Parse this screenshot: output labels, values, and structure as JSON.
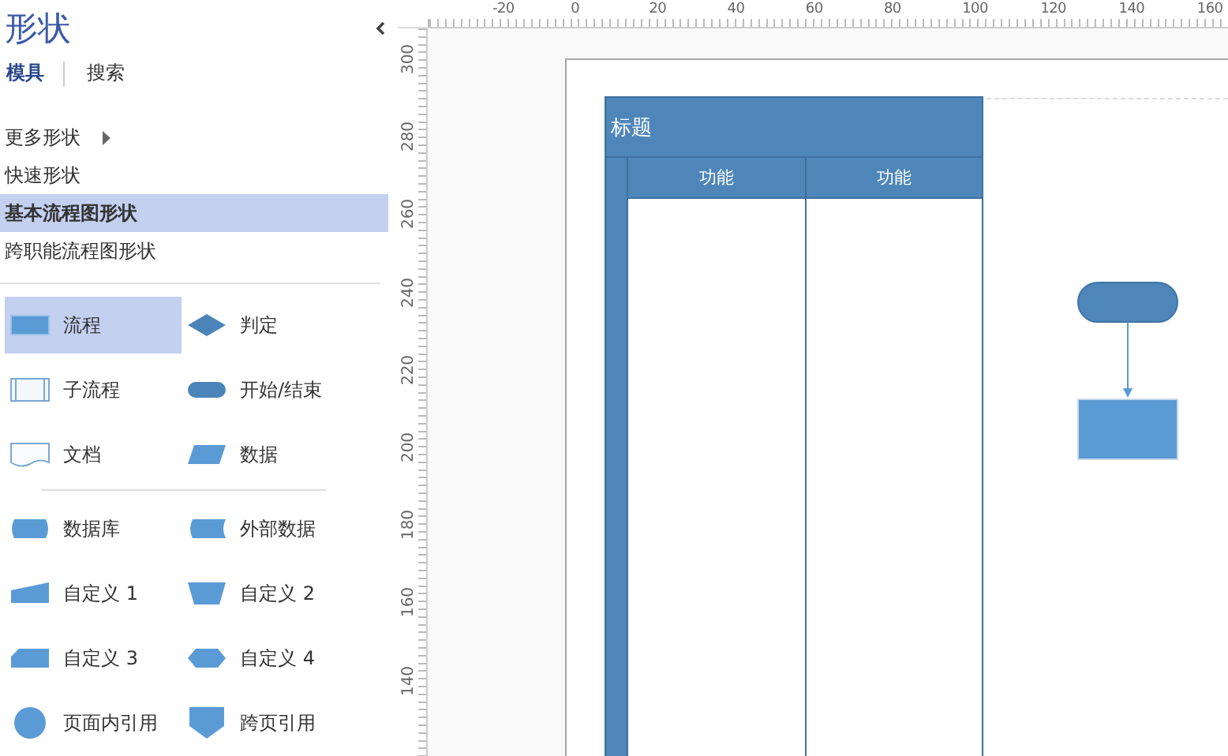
{
  "panel": {
    "title": "形状",
    "tabs": [
      {
        "label": "模具",
        "selected": true
      },
      {
        "label": "搜索",
        "selected": false
      }
    ],
    "stencils": [
      {
        "label": "更多形状",
        "kind": "submenu",
        "selected": false
      },
      {
        "label": "快速形状",
        "kind": "item",
        "selected": false
      },
      {
        "label": "基本流程图形状",
        "kind": "item",
        "selected": true
      },
      {
        "label": "跨职能流程图形状",
        "kind": "item",
        "selected": false
      }
    ],
    "shapes": [
      {
        "label": "流程",
        "kind": "process",
        "selected": true
      },
      {
        "label": "判定",
        "kind": "decision",
        "selected": false
      },
      {
        "label": "子流程",
        "kind": "subprocess",
        "selected": false
      },
      {
        "label": "开始/结束",
        "kind": "terminator",
        "selected": false
      },
      {
        "label": "文档",
        "kind": "document",
        "selected": false
      },
      {
        "label": "数据",
        "kind": "data",
        "selected": false
      }
    ],
    "more_shapes": [
      {
        "label": "数据库",
        "kind": "database",
        "selected": false
      },
      {
        "label": "外部数据",
        "kind": "external",
        "selected": false
      },
      {
        "label": "自定义 1",
        "kind": "custom1",
        "selected": false
      },
      {
        "label": "自定义 2",
        "kind": "custom2",
        "selected": false
      },
      {
        "label": "自定义 3",
        "kind": "custom3",
        "selected": false
      },
      {
        "label": "自定义 4",
        "kind": "custom4",
        "selected": false
      },
      {
        "label": "页面内引用",
        "kind": "onpage",
        "selected": false
      },
      {
        "label": "跨页引用",
        "kind": "offpage",
        "selected": false
      }
    ]
  },
  "ruler": {
    "x_labels": [
      "-20",
      "0",
      "20",
      "40",
      "60",
      "80",
      "100",
      "120",
      "140",
      "160"
    ],
    "y_labels": [
      "300",
      "280",
      "260",
      "240",
      "220",
      "200",
      "180",
      "160",
      "140"
    ]
  },
  "diagram": {
    "pool_title": "标题",
    "lanes": [
      "功能",
      "功能"
    ]
  }
}
